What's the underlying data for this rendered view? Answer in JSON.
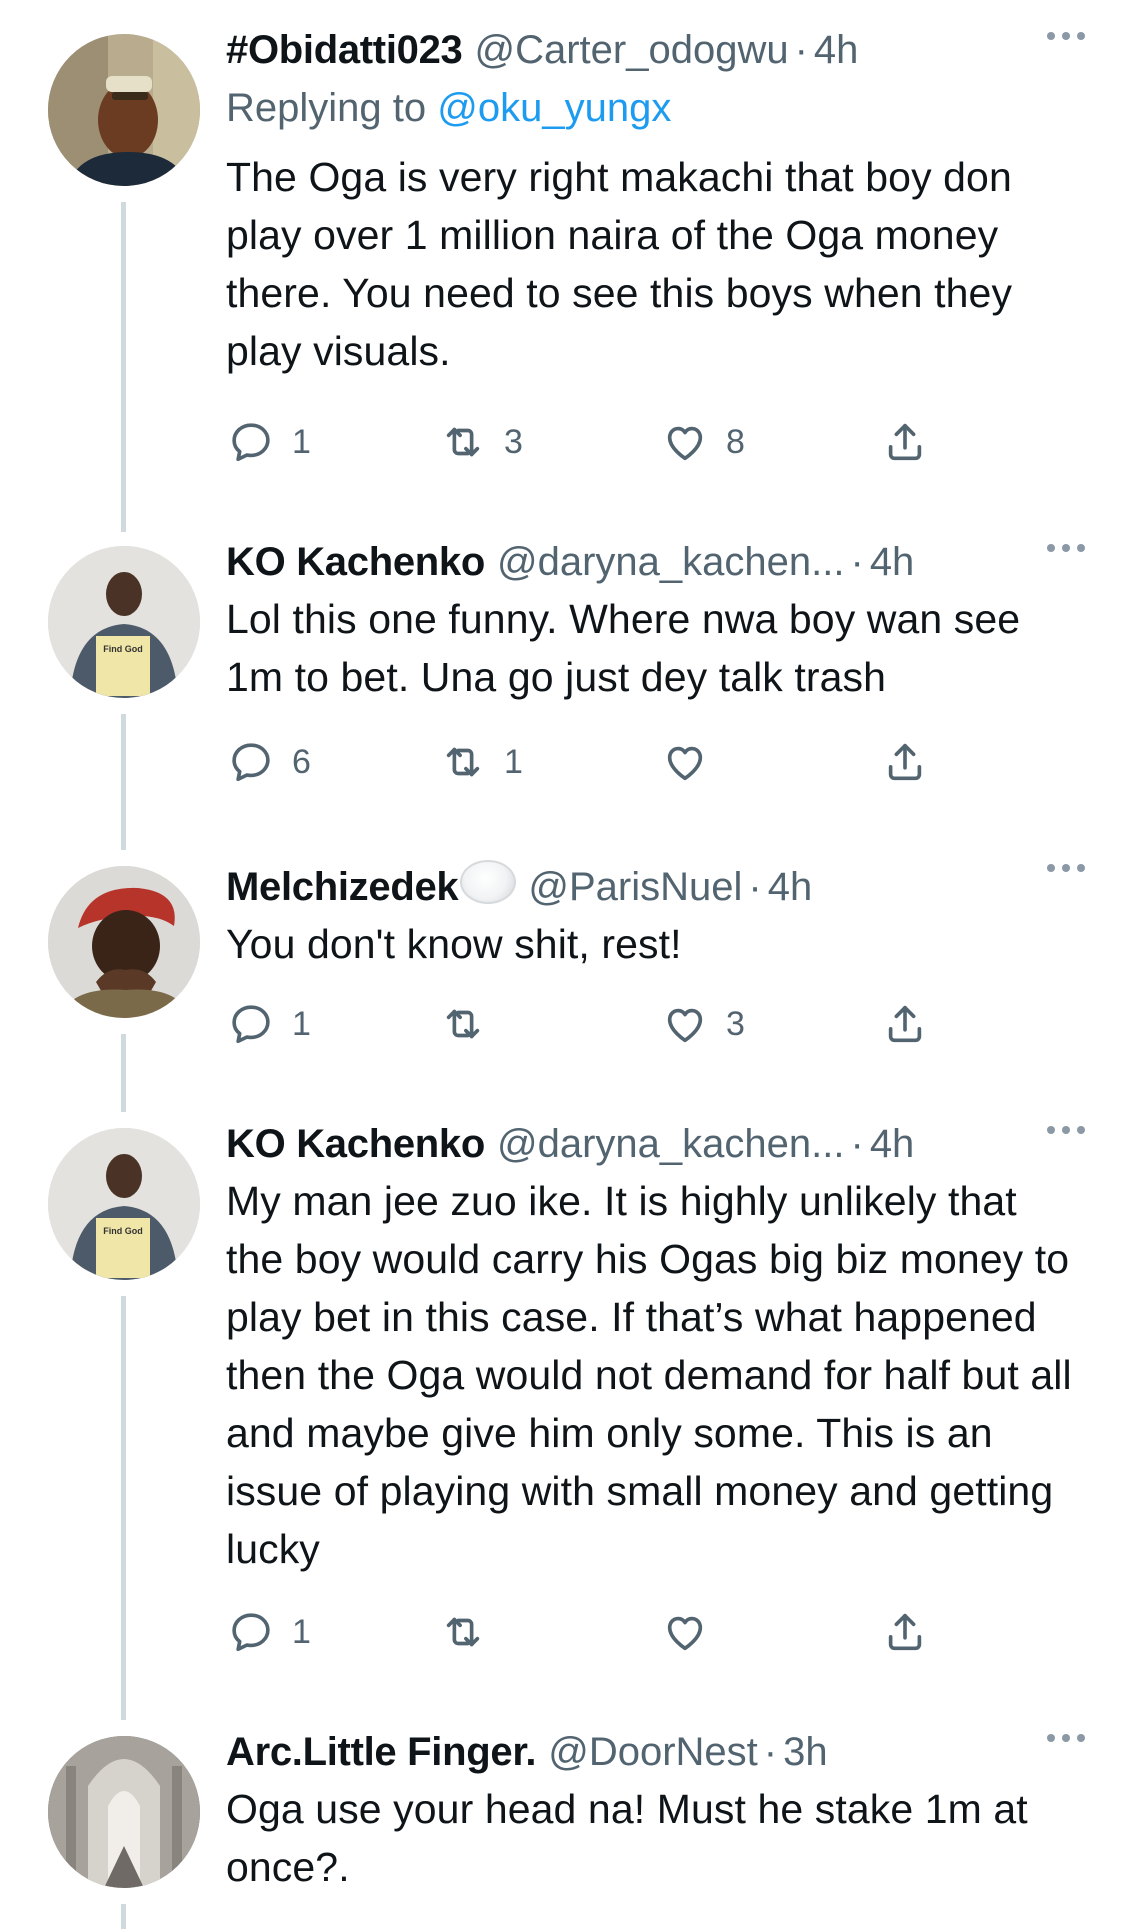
{
  "tweets": [
    {
      "display_name": "#Obidatti023",
      "handle": "@Carter_odogwu",
      "time": "4h",
      "replying_label": "Replying to",
      "replying_handle": "@oku_yungx",
      "text": "The Oga is very right makachi that boy don play over 1 million naira of the Oga money there. You need to see this boys when they play visuals.",
      "replies": "1",
      "retweets": "3",
      "likes": "8",
      "avatar_icon": "person-avatar-icon"
    },
    {
      "display_name": "KO Kachenko",
      "handle": "@daryna_kachen...",
      "time": "4h",
      "text": "Lol this one funny. Where nwa boy wan see 1m to bet. Una go just dey talk trash",
      "replies": "6",
      "retweets": "1",
      "likes": "",
      "avatar_text": "Find God"
    },
    {
      "display_name": "Melchizedek",
      "handle": "@ParisNuel",
      "time": "4h",
      "text": "You don't know shit, rest!",
      "replies": "1",
      "retweets": "",
      "likes": "3"
    },
    {
      "display_name": "KO Kachenko",
      "handle": "@daryna_kachen...",
      "time": "4h",
      "text": "My man jee zuo ike. It is highly unlikely that the boy would carry his Ogas big biz money to play bet in this case. If that’s what happened then the Oga would not demand for half but all and maybe give him only some. This is an issue of playing with small money and getting lucky",
      "replies": "1",
      "retweets": "",
      "likes": "",
      "avatar_text": "Find God"
    },
    {
      "display_name": "Arc.Little Finger.",
      "handle": "@DoorNest",
      "time": "3h",
      "text": "Oga use your head na! Must he stake 1m at once?."
    }
  ],
  "separator": "·",
  "colors": {
    "text": "#0f1419",
    "secondary": "#536471",
    "link": "#1d9bf0",
    "thread_line": "#cfd9de",
    "icon": "#536471"
  }
}
